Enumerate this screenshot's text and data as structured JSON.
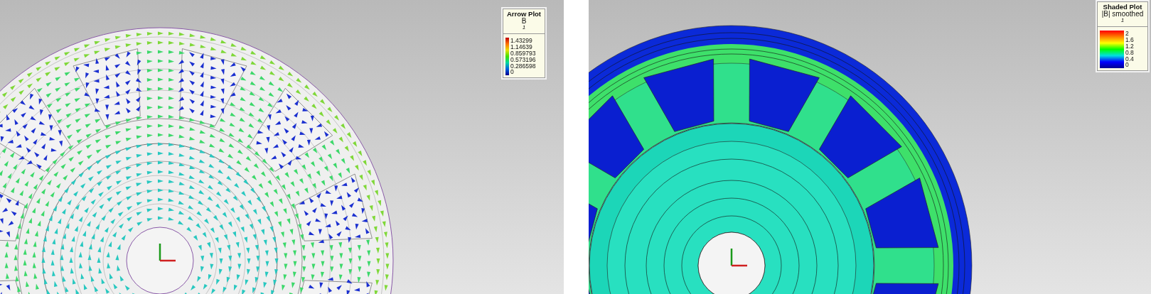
{
  "panels": [
    {
      "kind": "arrow",
      "legend": {
        "title": "Arrow Plot",
        "quantity": "B",
        "step": "1",
        "ticks": [
          "1.43299",
          "1.14639",
          "0.859793",
          "0.573196",
          "0.286598",
          "0"
        ]
      }
    },
    {
      "kind": "shaded",
      "legend": {
        "title": "Shaded Plot",
        "quantity": "|B| smoothed",
        "step": "1",
        "ticks": [
          "2",
          "1.6",
          "1.2",
          "0.8",
          "0.4",
          "0"
        ]
      }
    }
  ]
}
